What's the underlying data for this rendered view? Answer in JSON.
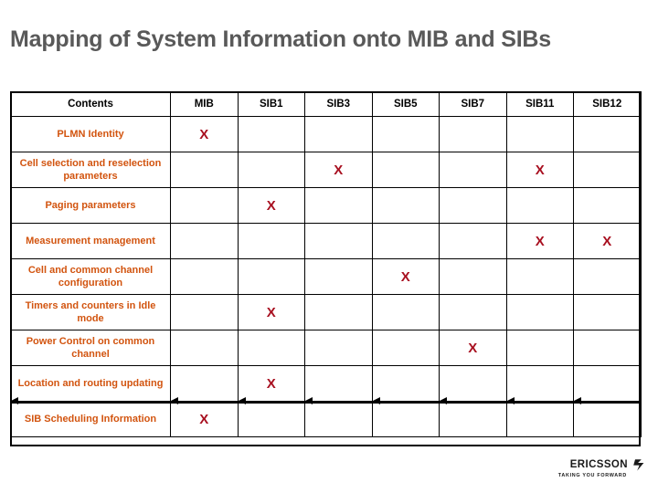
{
  "slide": {
    "title": "Mapping of System Information onto MIB and SIBs",
    "title_color": "#595959",
    "background": "#ffffff"
  },
  "table": {
    "name": "system-information-mapping-table",
    "mark_glyph": "X",
    "mark_color": "#A81020",
    "label_color": "#D2540F",
    "header_color": "#000000",
    "border_color": "#000000",
    "columns": [
      "Contents",
      "MIB",
      "SIB1",
      "SIB3",
      "SIB5",
      "SIB7",
      "SIB11",
      "SIB12"
    ],
    "rows": [
      {
        "label": "PLMN Identity",
        "marks": [
          "MIB"
        ]
      },
      {
        "label": "Cell selection and reselection parameters",
        "marks": [
          "SIB3",
          "SIB11"
        ]
      },
      {
        "label": "Paging parameters",
        "marks": [
          "SIB1"
        ]
      },
      {
        "label": "Measurement management",
        "marks": [
          "SIB11",
          "SIB12"
        ]
      },
      {
        "label": "Cell and common channel configuration",
        "marks": [
          "SIB5"
        ]
      },
      {
        "label": "Timers and counters in Idle mode",
        "marks": [
          "SIB1"
        ]
      },
      {
        "label": "Power Control on common channel",
        "marks": [
          "SIB7"
        ]
      },
      {
        "label": "Location and routing updating",
        "marks": [
          "SIB1"
        ]
      },
      {
        "label": "SIB Scheduling Information",
        "marks": [
          "MIB"
        ]
      }
    ],
    "divider": {
      "after_row_index": 7,
      "arrow_direction": "left",
      "arrow_count": 8
    }
  },
  "logo": {
    "wordmark": "ERICSSON",
    "tagline": "TAKING YOU FORWARD"
  }
}
